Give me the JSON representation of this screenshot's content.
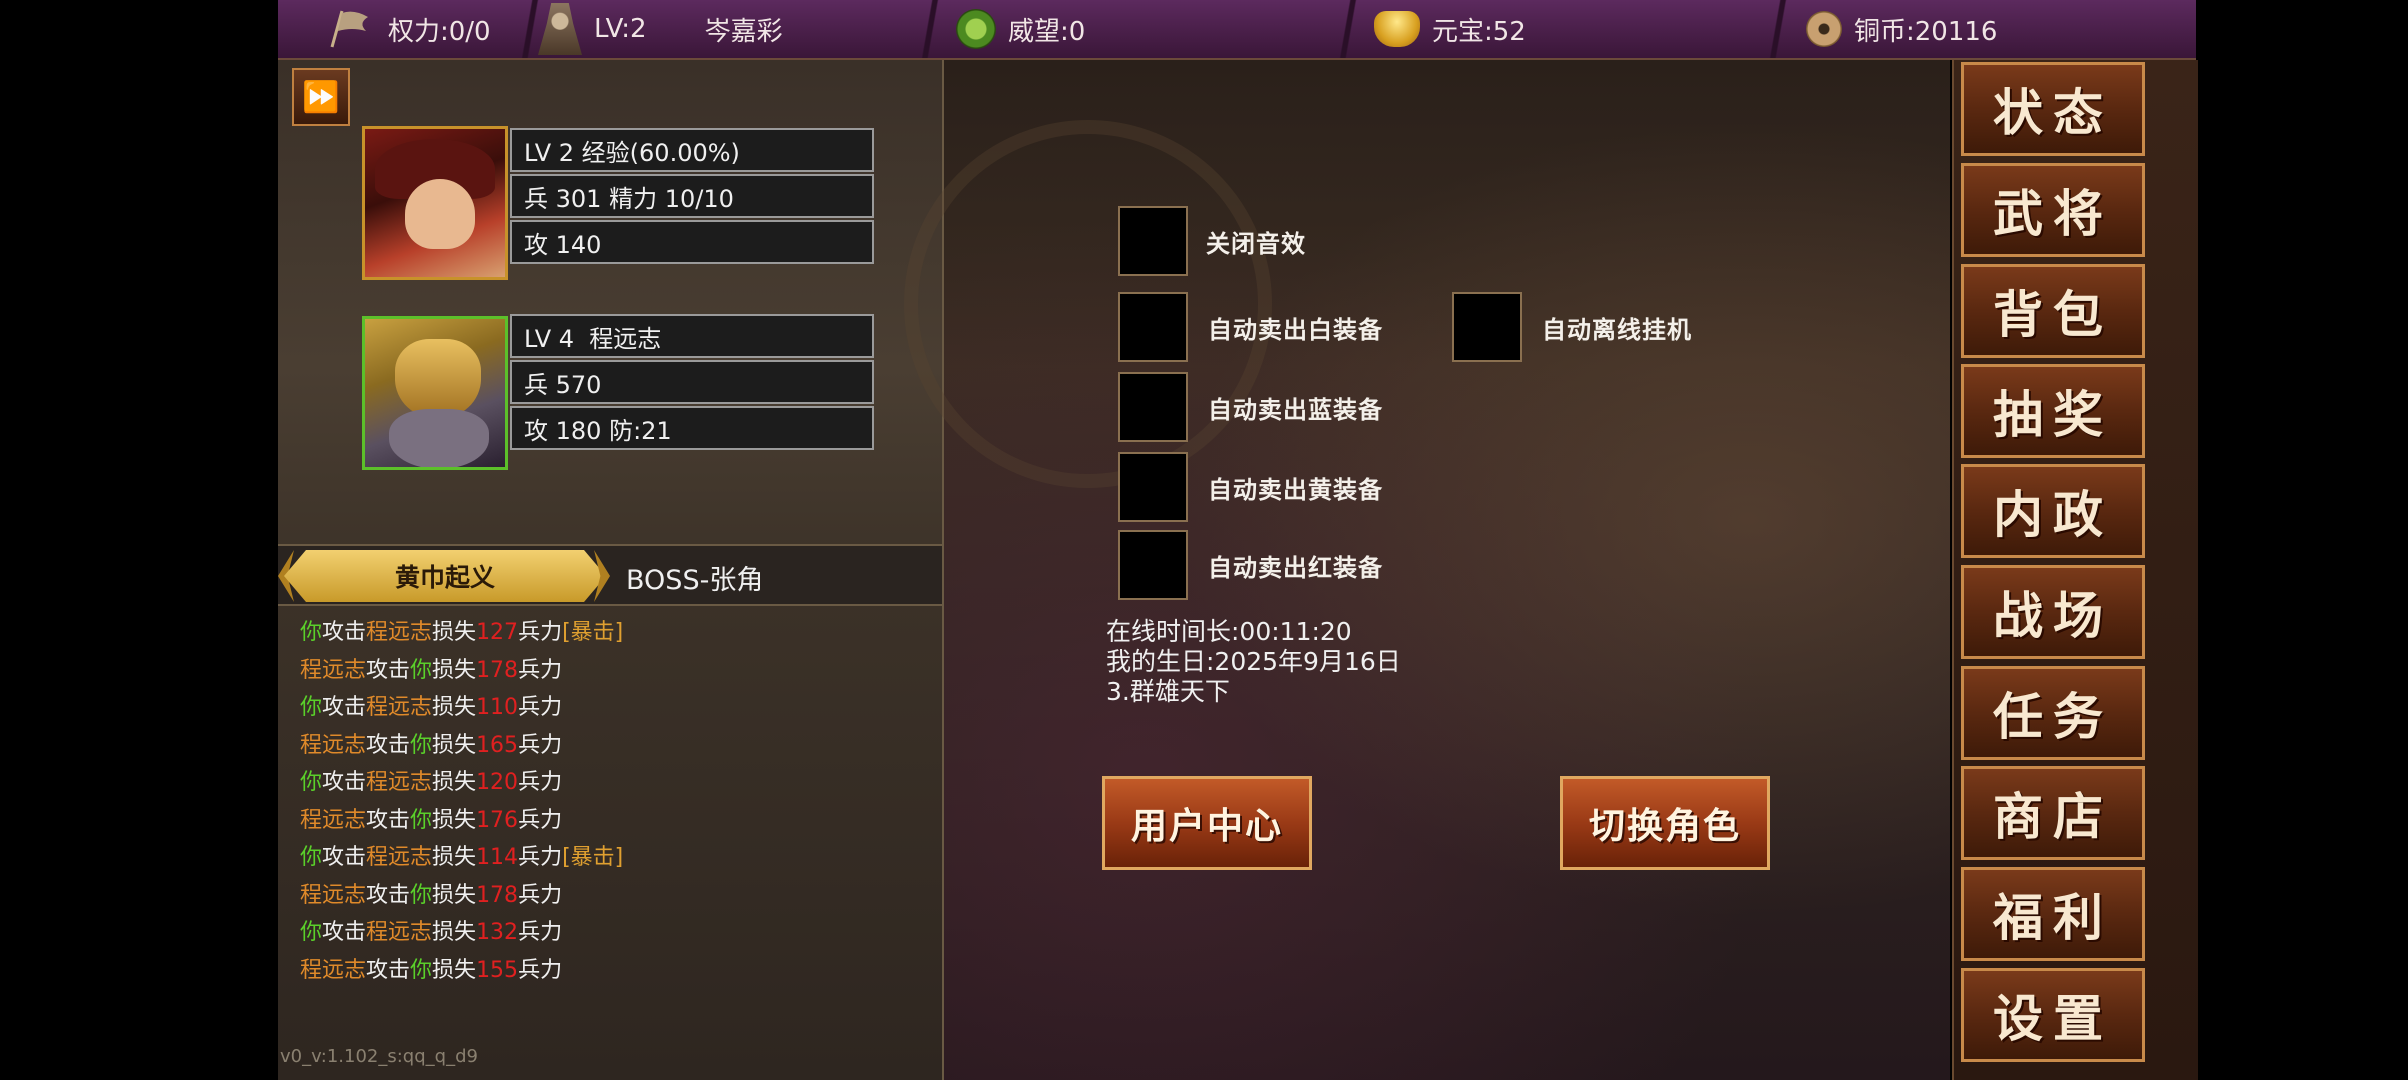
{
  "topbar": {
    "power": "权力:0/0",
    "level": "LV:2",
    "player_name": "岑嘉彩",
    "prestige": "威望:0",
    "ingot": "元宝:52",
    "copper": "铜币:20116"
  },
  "heroes": [
    {
      "line1": "LV 2 经验(60.00%)",
      "line2": "兵 301 精力 10/10",
      "line3": "攻 140"
    },
    {
      "line1": "LV 4  程远志",
      "line2": "兵 570",
      "line3": "攻 180 防:21"
    }
  ],
  "battle": {
    "stage_label": "黄巾起义",
    "boss_label": "BOSS-张角",
    "log": [
      {
        "attacker": "你",
        "verb": "攻击",
        "target": "程远志",
        "loss": "损失",
        "num": "127",
        "unit": "兵力",
        "crit": "[暴击]",
        "you_first": true
      },
      {
        "attacker": "程远志",
        "verb": "攻击",
        "target": "你",
        "loss": "损失",
        "num": "178",
        "unit": "兵力",
        "crit": "",
        "you_first": false
      },
      {
        "attacker": "你",
        "verb": "攻击",
        "target": "程远志",
        "loss": "损失",
        "num": "110",
        "unit": "兵力",
        "crit": "",
        "you_first": true
      },
      {
        "attacker": "程远志",
        "verb": "攻击",
        "target": "你",
        "loss": "损失",
        "num": "165",
        "unit": "兵力",
        "crit": "",
        "you_first": false
      },
      {
        "attacker": "你",
        "verb": "攻击",
        "target": "程远志",
        "loss": "损失",
        "num": "120",
        "unit": "兵力",
        "crit": "",
        "you_first": true
      },
      {
        "attacker": "程远志",
        "verb": "攻击",
        "target": "你",
        "loss": "损失",
        "num": "176",
        "unit": "兵力",
        "crit": "",
        "you_first": false
      },
      {
        "attacker": "你",
        "verb": "攻击",
        "target": "程远志",
        "loss": "损失",
        "num": "114",
        "unit": "兵力",
        "crit": "[暴击]",
        "you_first": true
      },
      {
        "attacker": "程远志",
        "verb": "攻击",
        "target": "你",
        "loss": "损失",
        "num": "178",
        "unit": "兵力",
        "crit": "",
        "you_first": false
      },
      {
        "attacker": "你",
        "verb": "攻击",
        "target": "程远志",
        "loss": "损失",
        "num": "132",
        "unit": "兵力",
        "crit": "",
        "you_first": true
      },
      {
        "attacker": "程远志",
        "verb": "攻击",
        "target": "你",
        "loss": "损失",
        "num": "155",
        "unit": "兵力",
        "crit": "",
        "you_first": false
      }
    ],
    "version": "v0_v:1.102_s:qq_q_d9"
  },
  "settings": {
    "mute_sound": "关闭音效",
    "auto_sell_white": "自动卖出白装备",
    "auto_offline": "自动离线挂机",
    "auto_sell_blue": "自动卖出蓝装备",
    "auto_sell_yellow": "自动卖出黄装备",
    "auto_sell_red": "自动卖出红装备",
    "online_time": "在线时间长:00:11:20",
    "birthday": "我的生日:2025年9月16日",
    "server": "3.群雄天下",
    "user_center": "用户中心",
    "switch_role": "切换角色"
  },
  "menu": [
    "状态",
    "武将",
    "背包",
    "抽奖",
    "内政",
    "战场",
    "任务",
    "商店",
    "福利",
    "设置"
  ]
}
